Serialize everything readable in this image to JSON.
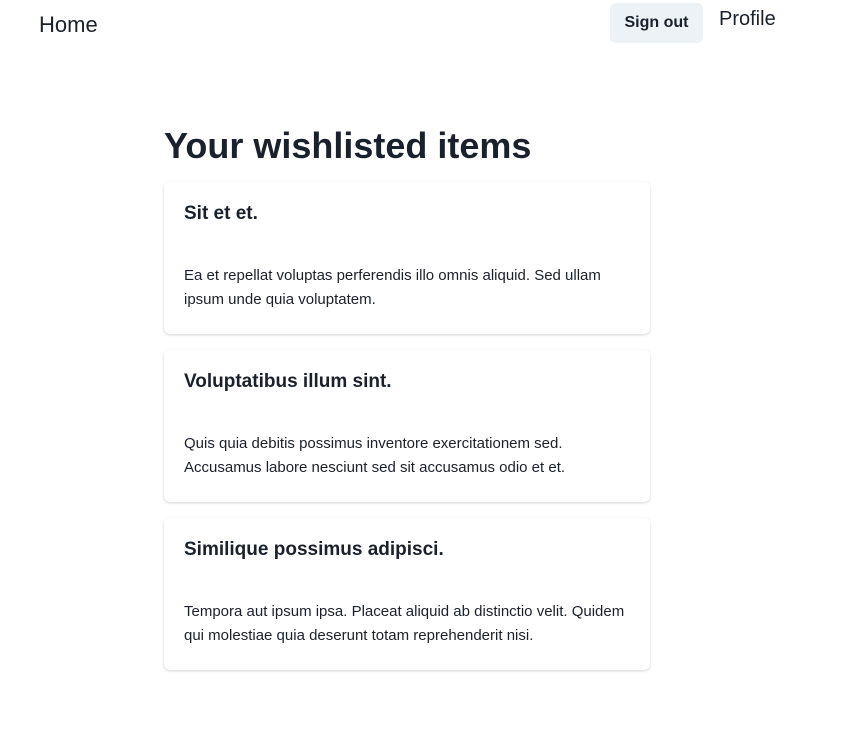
{
  "nav": {
    "home_label": "Home",
    "signout_label": "Sign out",
    "profile_label": "Profile"
  },
  "main": {
    "title": "Your wishlisted items",
    "items": [
      {
        "title": "Sit et et.",
        "description": "Ea et repellat voluptas perferendis illo omnis aliquid. Sed ullam ipsum unde quia voluptatem."
      },
      {
        "title": "Voluptatibus illum sint.",
        "description": "Quis quia debitis possimus inventore exercitationem sed. Accusamus labore nesciunt sed sit accusamus odio et et."
      },
      {
        "title": "Similique possimus adipisci.",
        "description": "Tempora aut ipsum ipsa. Placeat aliquid ab distinctio velit. Quidem qui molestiae quia deserunt totam reprehenderit nisi."
      }
    ]
  },
  "colors": {
    "text": "#1a202c",
    "button_bg": "#edf2f7",
    "background": "#ffffff"
  }
}
